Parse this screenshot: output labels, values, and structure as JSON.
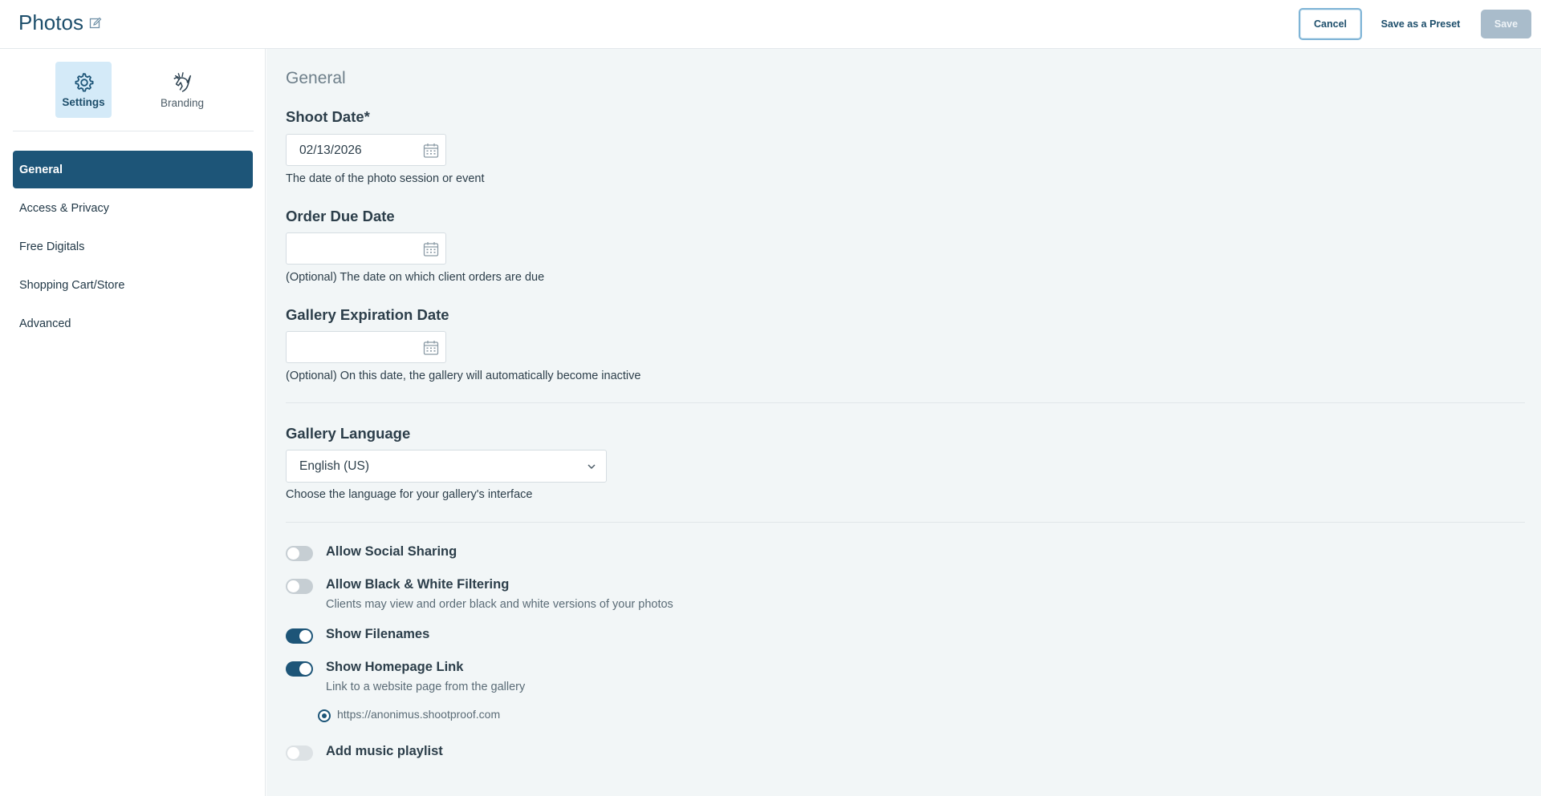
{
  "header": {
    "title": "Photos",
    "cancel_label": "Cancel",
    "preset_label": "Save as a Preset",
    "save_label": "Save"
  },
  "sidebar": {
    "top_tabs": [
      {
        "label": "Settings",
        "icon": "gear-icon"
      },
      {
        "label": "Branding",
        "icon": "unicorn-icon"
      }
    ],
    "items": [
      {
        "label": "General"
      },
      {
        "label": "Access & Privacy"
      },
      {
        "label": "Free Digitals"
      },
      {
        "label": "Shopping Cart/Store"
      },
      {
        "label": "Advanced"
      }
    ]
  },
  "main": {
    "section_title": "General",
    "shoot_date": {
      "label": "Shoot Date*",
      "value": "02/13/2026",
      "help": "The date of the photo session or event"
    },
    "order_due": {
      "label": "Order Due Date",
      "value": "",
      "help": "(Optional) The date on which client orders are due"
    },
    "expiration": {
      "label": "Gallery Expiration Date",
      "value": "",
      "help": "(Optional) On this date, the gallery will automatically become inactive"
    },
    "language": {
      "label": "Gallery Language",
      "value": "English (US)",
      "help": "Choose the language for your gallery's interface"
    },
    "toggles": [
      {
        "label": "Allow Social Sharing",
        "on": false,
        "sub": ""
      },
      {
        "label": "Allow Black & White Filtering",
        "on": false,
        "sub": "Clients may view and order black and white versions of your photos"
      },
      {
        "label": "Show Filenames",
        "on": true,
        "sub": ""
      },
      {
        "label": "Show Homepage Link",
        "on": true,
        "sub": "Link to a website page from the gallery"
      },
      {
        "label": "Add music playlist",
        "on": false,
        "sub": ""
      }
    ],
    "homepage_url": "https://anonimus.shootproof.com"
  },
  "colors": {
    "accent": "#1d5578",
    "active_tab_bg": "#d4eaf8",
    "save_disabled": "#a9bccb"
  }
}
